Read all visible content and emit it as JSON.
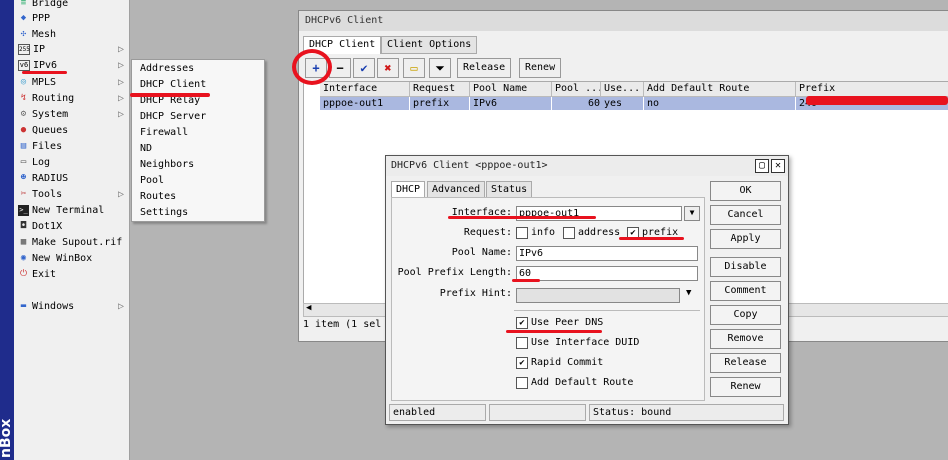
{
  "app": {
    "brand_text": "nBox"
  },
  "left_menu": {
    "items": [
      {
        "label": "Bridge",
        "icon": "bridge-icon",
        "arrow": false
      },
      {
        "label": "PPP",
        "icon": "ppp-icon",
        "arrow": false
      },
      {
        "label": "Mesh",
        "icon": "mesh-icon",
        "arrow": false
      },
      {
        "label": "IP",
        "icon": "ip-icon",
        "arrow": true,
        "badge": "255"
      },
      {
        "label": "IPv6",
        "icon": "ipv6-icon",
        "arrow": true,
        "badge": "v6"
      },
      {
        "label": "MPLS",
        "icon": "mpls-icon",
        "arrow": true
      },
      {
        "label": "Routing",
        "icon": "routing-icon",
        "arrow": true
      },
      {
        "label": "System",
        "icon": "system-icon",
        "arrow": true
      },
      {
        "label": "Queues",
        "icon": "queues-icon",
        "arrow": false
      },
      {
        "label": "Files",
        "icon": "files-icon",
        "arrow": false
      },
      {
        "label": "Log",
        "icon": "log-icon",
        "arrow": false
      },
      {
        "label": "RADIUS",
        "icon": "radius-icon",
        "arrow": false
      },
      {
        "label": "Tools",
        "icon": "tools-icon",
        "arrow": true
      },
      {
        "label": "New Terminal",
        "icon": "terminal-icon",
        "arrow": false
      },
      {
        "label": "Dot1X",
        "icon": "dot1x-icon",
        "arrow": false
      },
      {
        "label": "Make Supout.rif",
        "icon": "supout-icon",
        "arrow": false
      },
      {
        "label": "New WinBox",
        "icon": "winbox-icon",
        "arrow": false
      },
      {
        "label": "Exit",
        "icon": "exit-icon",
        "arrow": false
      },
      {
        "label": "Windows",
        "icon": "windows-icon",
        "arrow": true
      }
    ]
  },
  "submenu": {
    "items": [
      "Addresses",
      "DHCP Client",
      "DHCP Relay",
      "DHCP Server",
      "Firewall",
      "ND",
      "Neighbors",
      "Pool",
      "Routes",
      "Settings"
    ]
  },
  "main_window": {
    "title": "DHCPv6 Client",
    "tabs": [
      "DHCP Client",
      "Client Options"
    ],
    "toolbar": {
      "release_label": "Release",
      "renew_label": "Renew"
    },
    "columns": [
      "Interface",
      "Request",
      "Pool Name",
      "Pool ...",
      "Use...",
      "Add Default Route",
      "Prefix"
    ],
    "rows": [
      {
        "interface": "pppoe-out1",
        "request": "prefix",
        "pool_name": "IPv6",
        "pool_len": "60",
        "use_peer": "yes",
        "add_default": "no",
        "prefix": "240"
      }
    ],
    "status": "1 item (1 sel"
  },
  "dialog": {
    "title": "DHCPv6 Client <pppoe-out1>",
    "tabs": [
      "DHCP",
      "Advanced",
      "Status"
    ],
    "fields": {
      "interface_label": "Interface:",
      "interface_value": "pppoe-out1",
      "request_label": "Request:",
      "request_options": [
        {
          "label": "info",
          "checked": false
        },
        {
          "label": "address",
          "checked": false
        },
        {
          "label": "prefix",
          "checked": true
        }
      ],
      "pool_name_label": "Pool Name:",
      "pool_name_value": "IPv6",
      "pool_prefix_label": "Pool Prefix Length:",
      "pool_prefix_value": "60",
      "prefix_hint_label": "Prefix Hint:",
      "prefix_hint_value": ""
    },
    "checkboxes": [
      {
        "label": "Use Peer DNS",
        "checked": true
      },
      {
        "label": "Use Interface DUID",
        "checked": false
      },
      {
        "label": "Rapid Commit",
        "checked": true
      },
      {
        "label": "Add Default Route",
        "checked": false
      }
    ],
    "buttons": [
      "OK",
      "Cancel",
      "Apply",
      "Disable",
      "Comment",
      "Copy",
      "Remove",
      "Release",
      "Renew"
    ],
    "status_bar": {
      "left": "enabled",
      "middle": "",
      "right": "Status: bound"
    }
  },
  "colors": {
    "annotation_red": "#e8121e",
    "selected_row": "#aab8e0",
    "strip_blue": "#1f2c8c"
  }
}
